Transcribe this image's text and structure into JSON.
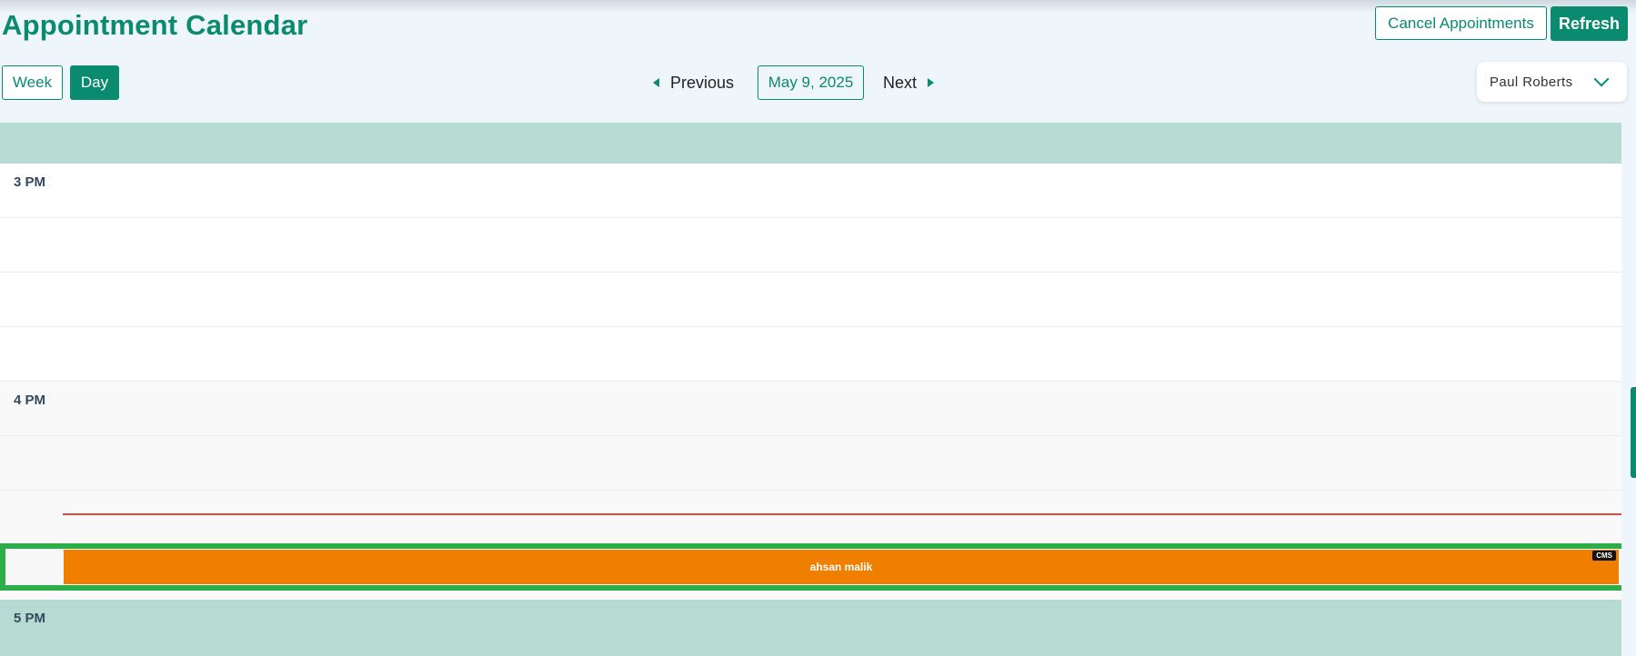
{
  "header": {
    "title": "Appointment Calendar",
    "cancel_label": "Cancel Appointments",
    "refresh_label": "Refresh"
  },
  "view_toggle": {
    "week_label": "Week",
    "day_label": "Day",
    "active": "Day"
  },
  "date_nav": {
    "previous_label": "Previous",
    "current_date": "May 9, 2025",
    "next_label": "Next"
  },
  "provider_select": {
    "selected": "Paul Roberts"
  },
  "calendar": {
    "hours": [
      "3 PM",
      "4 PM",
      "5 PM"
    ],
    "appointment": {
      "patient_name": "ahsan malik",
      "badge": "CMS",
      "color": "#f07f00"
    },
    "current_time_line_color": "#e04a3a",
    "header_color": "#b5dbd3"
  },
  "colors": {
    "accent": "#0a8a6f",
    "highlight": "#2eae4a"
  }
}
